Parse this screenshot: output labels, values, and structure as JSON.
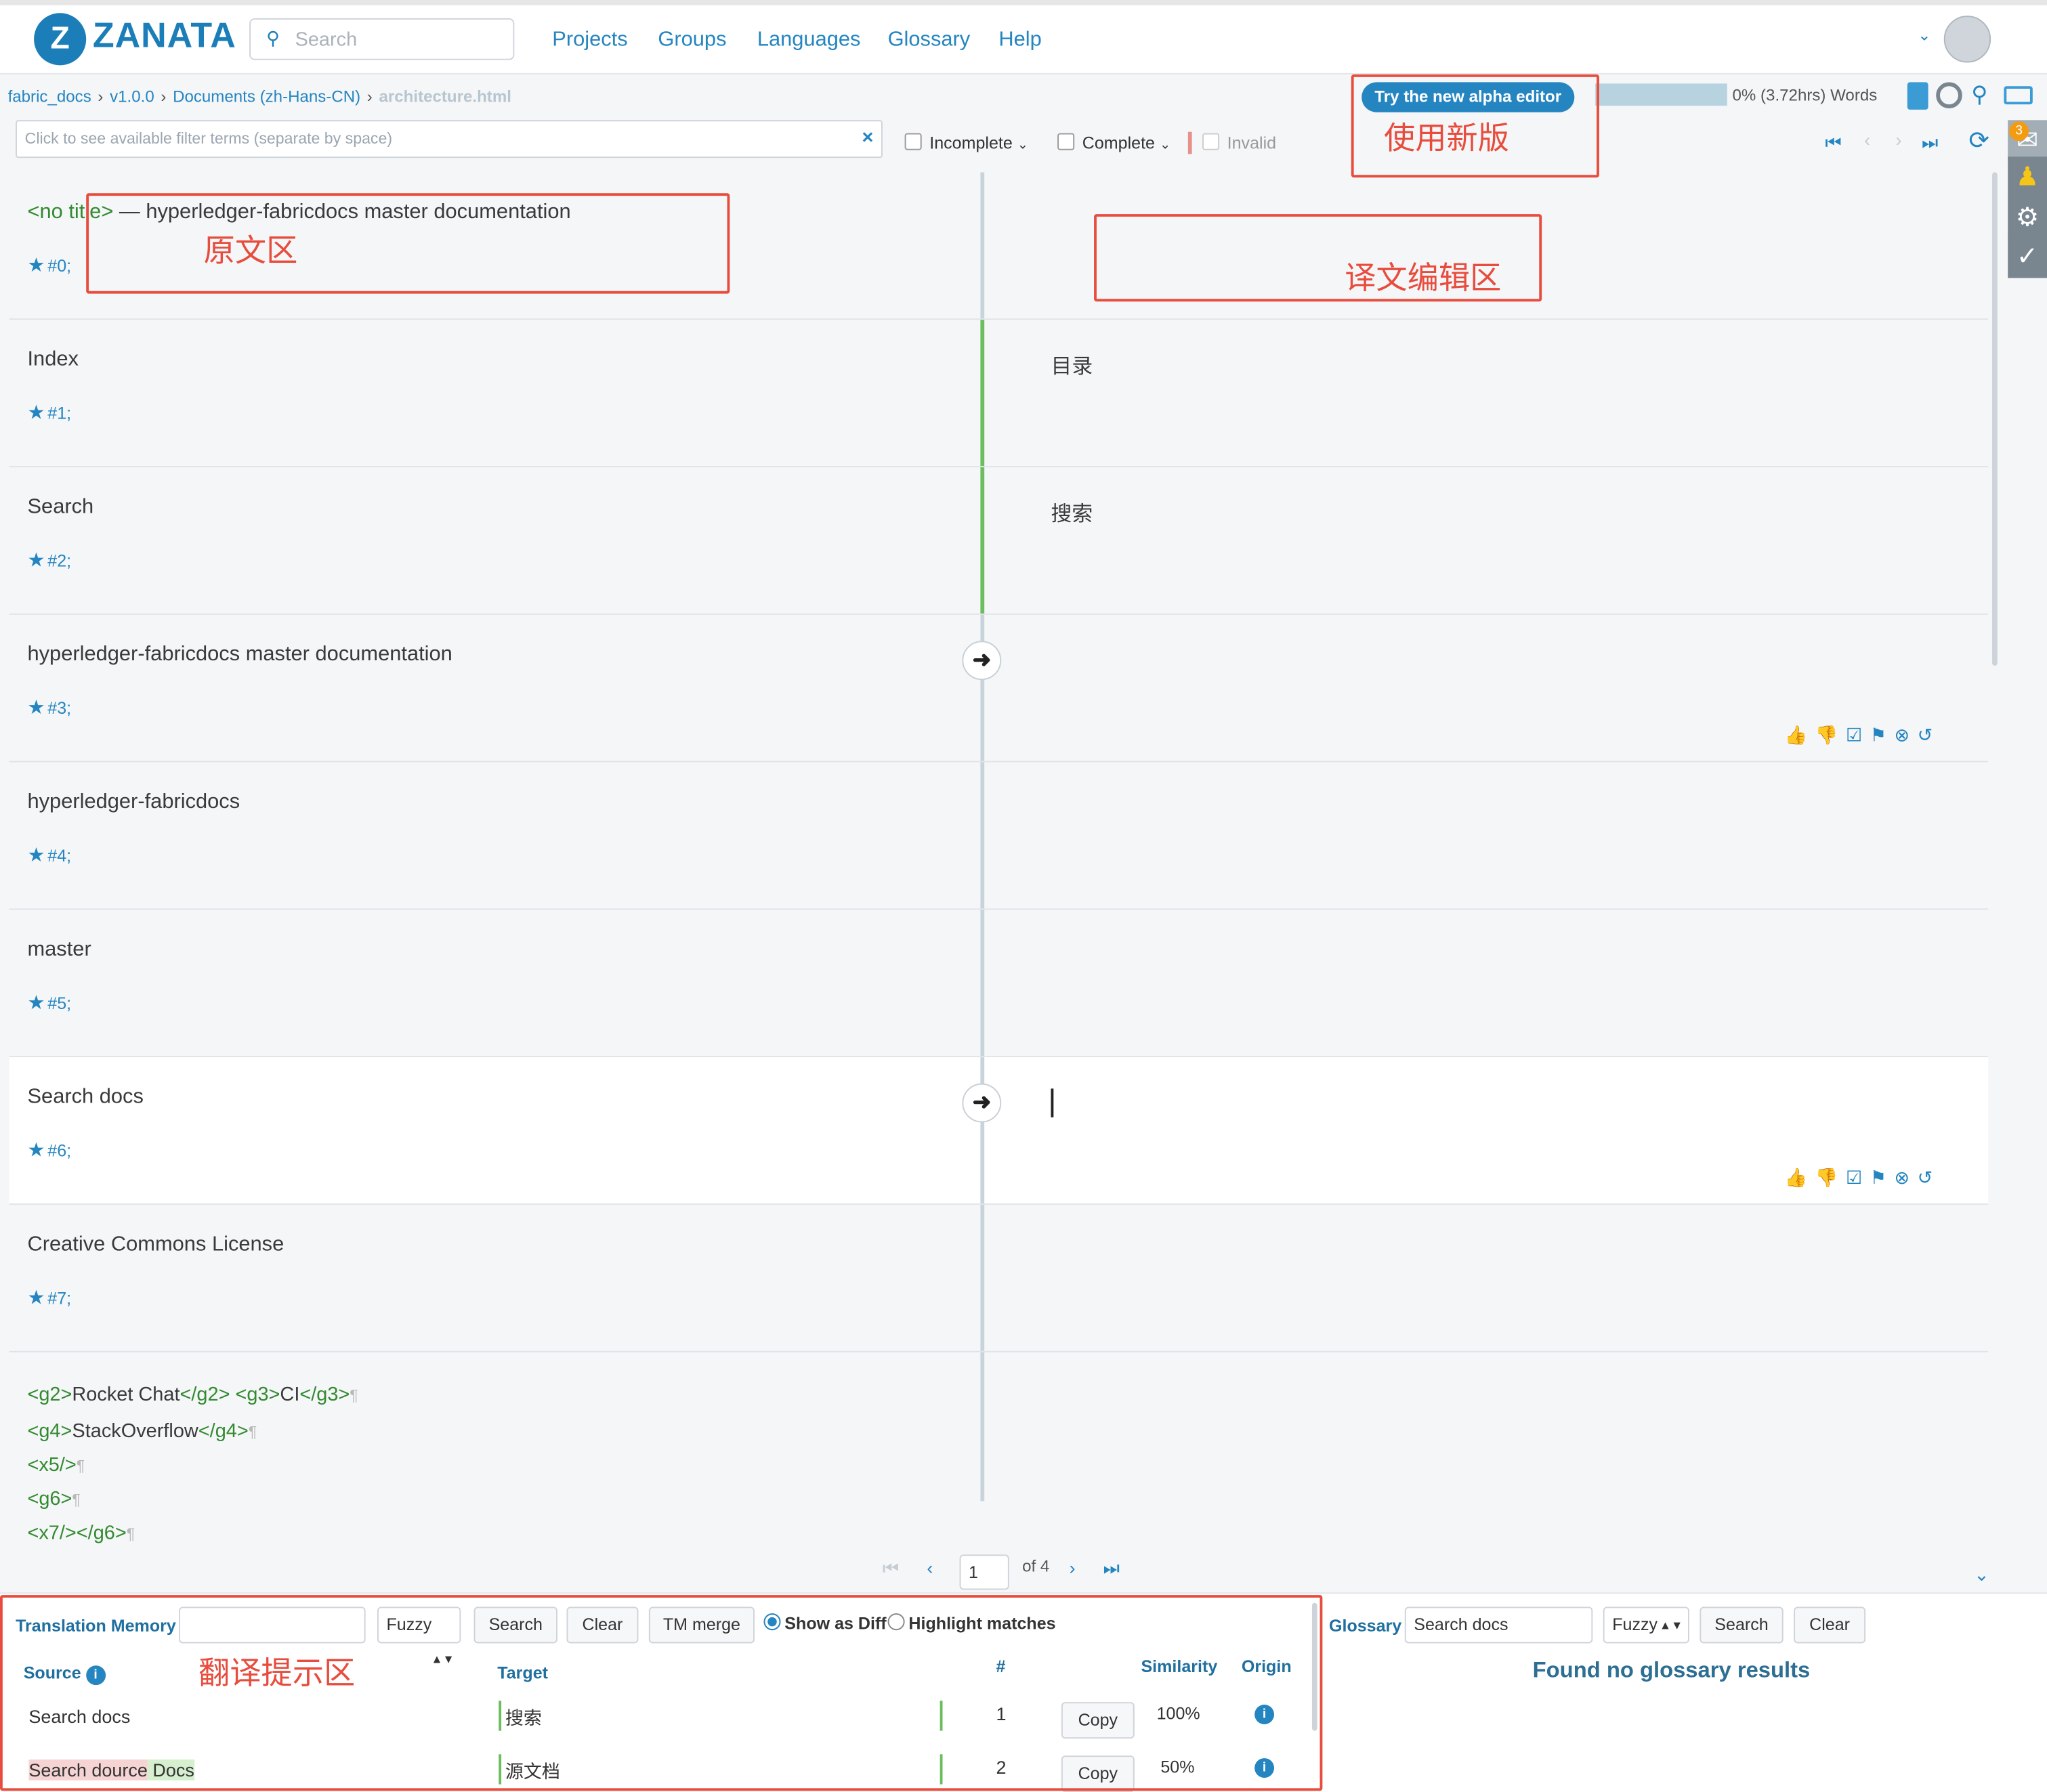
{
  "app": {
    "brand": "ZANATA",
    "logo_icon": "zanata-logo-icon",
    "accent": "#2485c1"
  },
  "header": {
    "search_placeholder": "Search",
    "nav": [
      "Projects",
      "Groups",
      "Languages",
      "Glossary",
      "Help"
    ]
  },
  "breadcrumb": [
    "fabric_docs",
    "v1.0.0",
    "Documents (zh-Hans-CN)",
    "architecture.html"
  ],
  "filter": {
    "placeholder": "Click to see available filter terms (separate by space)",
    "incomplete": "Incomplete",
    "complete": "Complete",
    "invalid": "Invalid"
  },
  "toolbar": {
    "alpha_button": "Try the new alpha editor",
    "progress_percent": 0,
    "progress_text": "0% (3.72hrs) Words",
    "notification_count": "3"
  },
  "annotations": {
    "new_version": "使用新版",
    "source_area": "原文区",
    "target_area": "译文编辑区",
    "suggest_area": "翻译提示区"
  },
  "rows": [
    {
      "source_tag_open": "<no title>",
      "source": "— hyperledger-fabricdocs master documentation",
      "index": "#0;",
      "target": ""
    },
    {
      "source": "Index",
      "index": "#1;",
      "target": "目录"
    },
    {
      "source": "Search",
      "index": "#2;",
      "target": "搜索"
    },
    {
      "source": "hyperledger-fabricdocs master documentation",
      "index": "#3;",
      "target": ""
    },
    {
      "source": "hyperledger-fabricdocs",
      "index": "#4;",
      "target": ""
    },
    {
      "source": "master",
      "index": "#5;",
      "target": ""
    },
    {
      "source": "Search docs",
      "index": "#6;",
      "target": ""
    },
    {
      "source": "Creative Commons License",
      "index": "#7;",
      "target": ""
    }
  ],
  "row8_lines": [
    {
      "a": "<g2>",
      "b": "Rocket Chat",
      "c": "</g2>",
      "d": " <g3>",
      "e": "CI",
      "f": "</g3>",
      "p": "¶"
    },
    {
      "a": "<g4>",
      "b": "StackOverflow",
      "c": "</g4>",
      "p": "¶"
    },
    {
      "a": "<x5/>",
      "p": "¶"
    },
    {
      "a": "<g6>",
      "p": "¶"
    },
    {
      "a": " <x7/></g6>",
      "p": "¶"
    }
  ],
  "pager": {
    "page": "1",
    "of": "of 4"
  },
  "tm": {
    "label": "Translation Memory",
    "mode": "Fuzzy",
    "search": "Search",
    "clear": "Clear",
    "merge": "TM merge",
    "show_diff": "Show as Diff",
    "highlight": "Highlight matches",
    "col_source": "Source",
    "col_target": "Target",
    "col_num": "#",
    "col_similarity": "Similarity",
    "col_origin": "Origin",
    "copy": "Copy",
    "results": [
      {
        "source": "Search docs",
        "target": "搜索",
        "num": "1",
        "similarity": "100%"
      },
      {
        "source_a": "Search ",
        "source_b": "dource",
        "source_c": " Docs",
        "target": "源文档",
        "num": "2",
        "similarity": "50%"
      }
    ]
  },
  "glossary": {
    "label": "Glossary",
    "input": "Search docs",
    "mode": "Fuzzy",
    "search": "Search",
    "clear": "Clear",
    "empty": "Found no glossary results"
  }
}
